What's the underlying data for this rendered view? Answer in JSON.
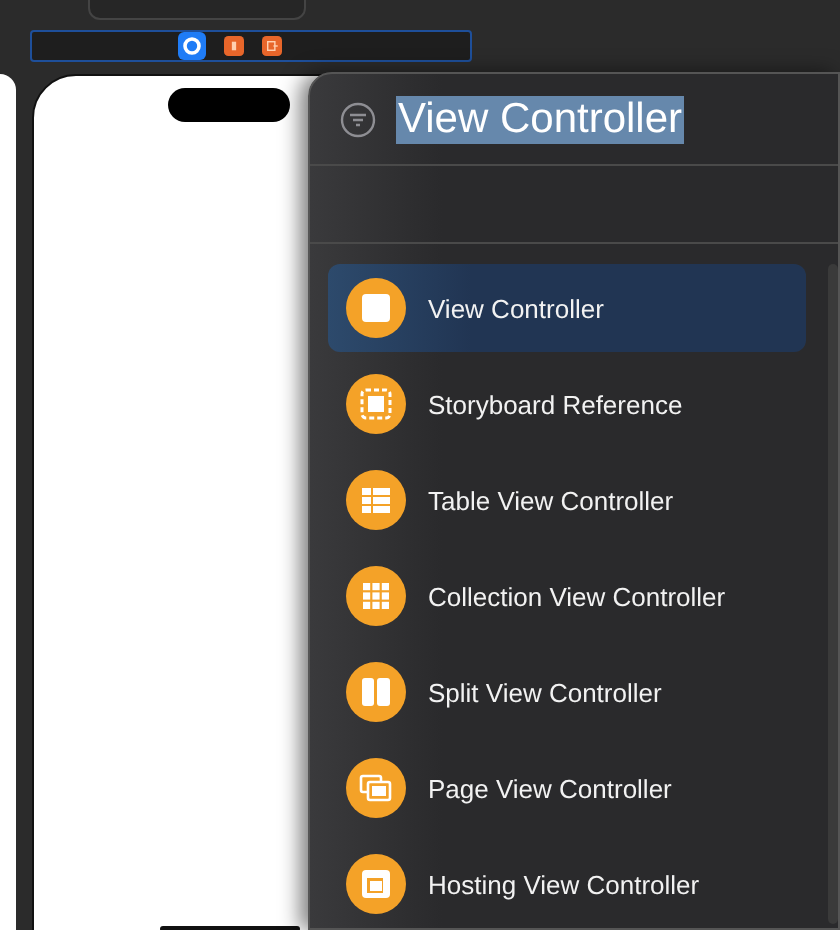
{
  "scene_dock": {
    "items": [
      {
        "kind": "controller",
        "selected": true
      },
      {
        "kind": "responder",
        "selected": false
      },
      {
        "kind": "exit",
        "selected": false
      }
    ]
  },
  "library": {
    "search": {
      "value": "View Controller",
      "text_selected": true
    },
    "items": [
      {
        "label": "View Controller",
        "kind": "view",
        "selected": true
      },
      {
        "label": "Storyboard Reference",
        "kind": "reference",
        "selected": false
      },
      {
        "label": "Table View Controller",
        "kind": "table",
        "selected": false
      },
      {
        "label": "Collection View Controller",
        "kind": "collection",
        "selected": false
      },
      {
        "label": "Split View Controller",
        "kind": "split",
        "selected": false
      },
      {
        "label": "Page View Controller",
        "kind": "page",
        "selected": false
      },
      {
        "label": "Hosting View Controller",
        "kind": "hosting",
        "selected": false
      }
    ]
  }
}
